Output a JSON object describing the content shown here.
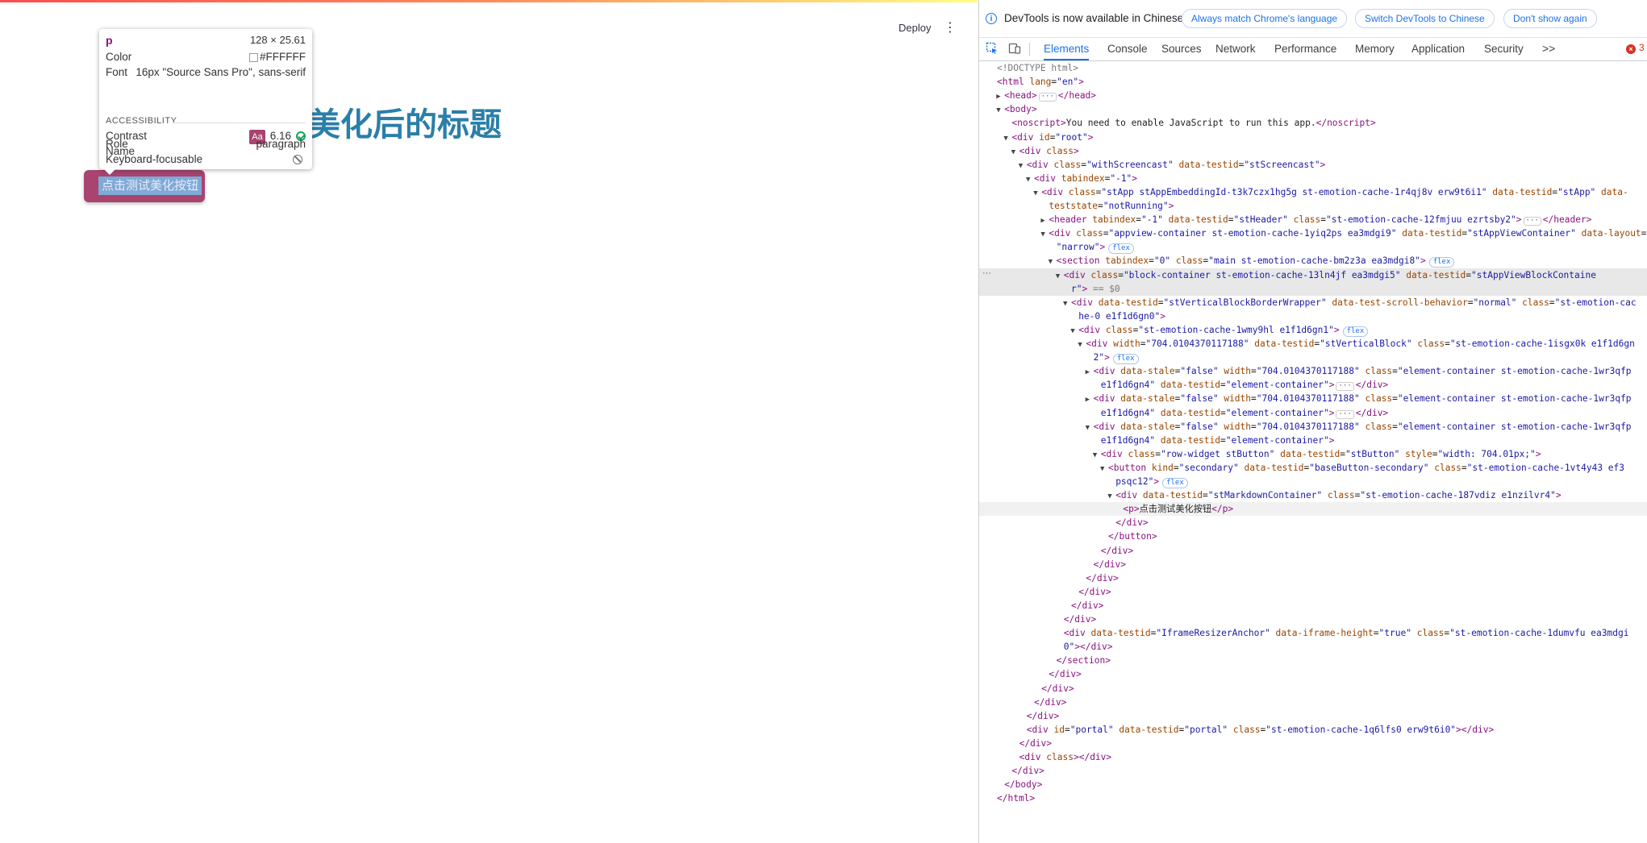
{
  "app": {
    "deploy_label": "Deploy",
    "kebab_icon": "⋮",
    "title_prefix": "",
    "title": "美化后的标题",
    "button_label": "点击测试美化按钮"
  },
  "inspector_tip": {
    "tag": "p",
    "size": "128 × 25.61",
    "color_label": "Color",
    "color_value": "#FFFFFF",
    "font_label": "Font",
    "font_value": "16px \"Source Sans Pro\", sans-serif",
    "section_label": "ACCESSIBILITY",
    "contrast_label": "Contrast",
    "contrast_aa": "Aa",
    "contrast_value": "6.16",
    "name_label": "Name",
    "role_label": "Role",
    "role_value": "paragraph",
    "keyboard_label": "Keyboard-focusable"
  },
  "devtools": {
    "notice": {
      "text": "DevTools is now available in Chinese!",
      "btn_match": "Always match Chrome's language",
      "btn_switch": "Switch DevTools to Chinese",
      "btn_dont": "Don't show again"
    },
    "tabs": {
      "elements": "Elements",
      "console": "Console",
      "sources": "Sources",
      "network": "Network",
      "performance": "Performance",
      "memory": "Memory",
      "application": "Application",
      "security": "Security",
      "more": ">>"
    },
    "error_count": "3",
    "dom_lines": [
      {
        "indent": 0,
        "tw": "",
        "html": "<span class=\"cm\">&lt;!DOCTYPE html&gt;</span>"
      },
      {
        "indent": 0,
        "tw": "",
        "html": "<span class=\"tag\">&lt;html</span> <span class=\"an\">lang</span>=<span class=\"av\">\"en\"</span><span class=\"tag\">&gt;</span>"
      },
      {
        "indent": 1,
        "tw": "▶",
        "html": "<span class=\"tag\">&lt;head&gt;</span><span class=\"ell\">···</span><span class=\"tag\">&lt;/head&gt;</span>"
      },
      {
        "indent": 1,
        "tw": "▼",
        "html": "<span class=\"tag\">&lt;body&gt;</span>"
      },
      {
        "indent": 2,
        "tw": "",
        "html": "<span class=\"tag\">&lt;noscript&gt;</span><span class=\"txt\">You need to enable JavaScript to run this app.</span><span class=\"tag\">&lt;/noscript&gt;</span>"
      },
      {
        "indent": 2,
        "tw": "▼",
        "html": "<span class=\"tag\">&lt;div</span> <span class=\"an\">id</span>=<span class=\"av\">\"root\"</span><span class=\"tag\">&gt;</span>"
      },
      {
        "indent": 3,
        "tw": "▼",
        "html": "<span class=\"tag\">&lt;div</span> <span class=\"an\">class</span><span class=\"tag\">&gt;</span>"
      },
      {
        "indent": 4,
        "tw": "▼",
        "html": "<span class=\"tag\">&lt;div</span> <span class=\"an\">class</span>=<span class=\"av\">\"withScreencast\"</span> <span class=\"an\">data-testid</span>=<span class=\"av\">\"stScreencast\"</span><span class=\"tag\">&gt;</span>"
      },
      {
        "indent": 5,
        "tw": "▼",
        "html": "<span class=\"tag\">&lt;div</span> <span class=\"an\">tabindex</span>=<span class=\"av\">\"-1\"</span><span class=\"tag\">&gt;</span>"
      },
      {
        "indent": 6,
        "tw": "▼",
        "html": "<span class=\"tag\">&lt;div</span> <span class=\"an\">class</span>=<span class=\"av\">\"stApp stAppEmbeddingId-t3k7czx1hg5g st-emotion-cache-1r4qj8v erw9t6i1\"</span> <span class=\"an\">data-testid</span>=<span class=\"av\">\"stApp\"</span> <span class=\"an\">data-</span>"
      },
      {
        "indent": 7,
        "tw": "",
        "html": "<span class=\"an\">teststate</span>=<span class=\"av\">\"notRunning\"</span><span class=\"tag\">&gt;</span>"
      },
      {
        "indent": 7,
        "tw": "▶",
        "html": "<span class=\"tag\">&lt;header</span> <span class=\"an\">tabindex</span>=<span class=\"av\">\"-1\"</span> <span class=\"an\">data-testid</span>=<span class=\"av\">\"stHeader\"</span> <span class=\"an\">class</span>=<span class=\"av\">\"st-emotion-cache-12fmjuu ezrtsby2\"</span><span class=\"tag\">&gt;</span><span class=\"ell\">···</span><span class=\"tag\">&lt;/header&gt;</span>"
      },
      {
        "indent": 7,
        "tw": "▼",
        "html": "<span class=\"tag\">&lt;div</span> <span class=\"an\">class</span>=<span class=\"av\">\"appview-container st-emotion-cache-1yiq2ps ea3mdgi9\"</span> <span class=\"an\">data-testid</span>=<span class=\"av\">\"stAppViewContainer\"</span> <span class=\"an\">data-layout</span>="
      },
      {
        "indent": 8,
        "tw": "",
        "html": "<span class=\"av\">\"narrow\"</span><span class=\"tag\">&gt;</span><span class=\"badge\">flex</span>"
      },
      {
        "indent": 8,
        "tw": "▼",
        "html": "<span class=\"tag\">&lt;section</span> <span class=\"an\">tabindex</span>=<span class=\"av\">\"0\"</span> <span class=\"an\">class</span>=<span class=\"av\">\"main st-emotion-cache-bm2z3a ea3mdgi8\"</span><span class=\"tag\">&gt;</span><span class=\"badge\">flex</span>"
      },
      {
        "indent": 9,
        "tw": "▼",
        "html": "<span class=\"tag\">&lt;div</span> <span class=\"an\">class</span>=<span class=\"av\">\"block-container st-emotion-cache-13ln4jf ea3mdgi5\"</span> <span class=\"an\">data-testid</span>=<span class=\"av\">\"stAppViewBlockContaine</span>",
        "cls": "hl"
      },
      {
        "indent": 10,
        "tw": "",
        "html": "<span class=\"av\">r\"</span><span class=\"tag\">&gt;</span> <span class=\"cm\">== $0</span>",
        "cls": "hl"
      },
      {
        "indent": 10,
        "tw": "▼",
        "html": "<span class=\"tag\">&lt;div</span> <span class=\"an\">data-testid</span>=<span class=\"av\">\"stVerticalBlockBorderWrapper\"</span> <span class=\"an\">data-test-scroll-behavior</span>=<span class=\"av\">\"normal\"</span> <span class=\"an\">class</span>=<span class=\"av\">\"st-emotion-cac</span>"
      },
      {
        "indent": 11,
        "tw": "",
        "html": "<span class=\"av\">he-0 e1f1d6gn0\"</span><span class=\"tag\">&gt;</span>"
      },
      {
        "indent": 11,
        "tw": "▼",
        "html": "<span class=\"tag\">&lt;div</span> <span class=\"an\">class</span>=<span class=\"av\">\"st-emotion-cache-1wmy9hl e1f1d6gn1\"</span><span class=\"tag\">&gt;</span><span class=\"badge\">flex</span>"
      },
      {
        "indent": 12,
        "tw": "▼",
        "html": "<span class=\"tag\">&lt;div</span> <span class=\"an\">width</span>=<span class=\"av\">\"704.0104370117188\"</span> <span class=\"an\">data-testid</span>=<span class=\"av\">\"stVerticalBlock\"</span> <span class=\"an\">class</span>=<span class=\"av\">\"st-emotion-cache-1isgx0k e1f1d6gn</span>"
      },
      {
        "indent": 13,
        "tw": "",
        "html": "<span class=\"av\">2\"</span><span class=\"tag\">&gt;</span><span class=\"badge\">flex</span>"
      },
      {
        "indent": 13,
        "tw": "▶",
        "html": "<span class=\"tag\">&lt;div</span> <span class=\"an\">data-stale</span>=<span class=\"av\">\"false\"</span> <span class=\"an\">width</span>=<span class=\"av\">\"704.0104370117188\"</span> <span class=\"an\">class</span>=<span class=\"av\">\"element-container st-emotion-cache-1wr3qfp</span>"
      },
      {
        "indent": 14,
        "tw": "",
        "html": "<span class=\"av\">e1f1d6gn4\"</span> <span class=\"an\">data-testid</span>=<span class=\"av\">\"element-container\"</span><span class=\"tag\">&gt;</span><span class=\"ell\">···</span><span class=\"tag\">&lt;/div&gt;</span>"
      },
      {
        "indent": 13,
        "tw": "▶",
        "html": "<span class=\"tag\">&lt;div</span> <span class=\"an\">data-stale</span>=<span class=\"av\">\"false\"</span> <span class=\"an\">width</span>=<span class=\"av\">\"704.0104370117188\"</span> <span class=\"an\">class</span>=<span class=\"av\">\"element-container st-emotion-cache-1wr3qfp</span>"
      },
      {
        "indent": 14,
        "tw": "",
        "html": "<span class=\"av\">e1f1d6gn4\"</span> <span class=\"an\">data-testid</span>=<span class=\"av\">\"element-container\"</span><span class=\"tag\">&gt;</span><span class=\"ell\">···</span><span class=\"tag\">&lt;/div&gt;</span>"
      },
      {
        "indent": 13,
        "tw": "▼",
        "html": "<span class=\"tag\">&lt;div</span> <span class=\"an\">data-stale</span>=<span class=\"av\">\"false\"</span> <span class=\"an\">width</span>=<span class=\"av\">\"704.0104370117188\"</span> <span class=\"an\">class</span>=<span class=\"av\">\"element-container st-emotion-cache-1wr3qfp</span>"
      },
      {
        "indent": 14,
        "tw": "",
        "html": "<span class=\"av\">e1f1d6gn4\"</span> <span class=\"an\">data-testid</span>=<span class=\"av\">\"element-container\"</span><span class=\"tag\">&gt;</span>"
      },
      {
        "indent": 14,
        "tw": "▼",
        "html": "<span class=\"tag\">&lt;div</span> <span class=\"an\">class</span>=<span class=\"av\">\"row-widget stButton\"</span> <span class=\"an\">data-testid</span>=<span class=\"av\">\"stButton\"</span> <span class=\"an\">style</span>=<span class=\"av\">\"width: 704.01px;\"</span><span class=\"tag\">&gt;</span>"
      },
      {
        "indent": 15,
        "tw": "▼",
        "html": "<span class=\"tag\">&lt;button</span> <span class=\"an\">kind</span>=<span class=\"av\">\"secondary\"</span> <span class=\"an\">data-testid</span>=<span class=\"av\">\"baseButton-secondary\"</span> <span class=\"an\">class</span>=<span class=\"av\">\"st-emotion-cache-1vt4y43 ef3</span>"
      },
      {
        "indent": 16,
        "tw": "",
        "html": "<span class=\"av\">psqc12\"</span><span class=\"tag\">&gt;</span><span class=\"badge\">flex</span>"
      },
      {
        "indent": 16,
        "tw": "▼",
        "html": "<span class=\"tag\">&lt;div</span> <span class=\"an\">data-testid</span>=<span class=\"av\">\"stMarkdownContainer\"</span> <span class=\"an\">class</span>=<span class=\"av\">\"st-emotion-cache-187vdiz e1nzilvr4\"</span><span class=\"tag\">&gt;</span>"
      },
      {
        "indent": 17,
        "tw": "",
        "html": "<span class=\"tag\">&lt;p&gt;</span><span class=\"txt\">点击测试美化按钮</span><span class=\"tag\">&lt;/p&gt;</span>",
        "cls": "sel"
      },
      {
        "indent": 16,
        "tw": "",
        "html": "<span class=\"tag\">&lt;/div&gt;</span>"
      },
      {
        "indent": 15,
        "tw": "",
        "html": "<span class=\"tag\">&lt;/button&gt;</span>"
      },
      {
        "indent": 14,
        "tw": "",
        "html": "<span class=\"tag\">&lt;/div&gt;</span>"
      },
      {
        "indent": 13,
        "tw": "",
        "html": "<span class=\"tag\">&lt;/div&gt;</span>"
      },
      {
        "indent": 12,
        "tw": "",
        "html": "<span class=\"tag\">&lt;/div&gt;</span>"
      },
      {
        "indent": 11,
        "tw": "",
        "html": "<span class=\"tag\">&lt;/div&gt;</span>"
      },
      {
        "indent": 10,
        "tw": "",
        "html": "<span class=\"tag\">&lt;/div&gt;</span>"
      },
      {
        "indent": 9,
        "tw": "",
        "html": "<span class=\"tag\">&lt;/div&gt;</span>"
      },
      {
        "indent": 9,
        "tw": "",
        "html": "<span class=\"tag\">&lt;div</span> <span class=\"an\">data-testid</span>=<span class=\"av\">\"IframeResizerAnchor\"</span> <span class=\"an\">data-iframe-height</span>=<span class=\"av\">\"true\"</span> <span class=\"an\">class</span>=<span class=\"av\">\"st-emotion-cache-1dumvfu ea3mdgi</span>"
      },
      {
        "indent": 9,
        "tw": "",
        "html": "<span class=\"av\">0\"</span><span class=\"tag\">&gt;&lt;/div&gt;</span>"
      },
      {
        "indent": 8,
        "tw": "",
        "html": "<span class=\"tag\">&lt;/section&gt;</span>"
      },
      {
        "indent": 7,
        "tw": "",
        "html": "<span class=\"tag\">&lt;/div&gt;</span>"
      },
      {
        "indent": 6,
        "tw": "",
        "html": "<span class=\"tag\">&lt;/div&gt;</span>"
      },
      {
        "indent": 5,
        "tw": "",
        "html": "<span class=\"tag\">&lt;/div&gt;</span>"
      },
      {
        "indent": 4,
        "tw": "",
        "html": "<span class=\"tag\">&lt;/div&gt;</span>"
      },
      {
        "indent": 4,
        "tw": "",
        "html": "<span class=\"tag\">&lt;div</span> <span class=\"an\">id</span>=<span class=\"av\">\"portal\"</span> <span class=\"an\">data-testid</span>=<span class=\"av\">\"portal\"</span> <span class=\"an\">class</span>=<span class=\"av\">\"st-emotion-cache-1q6lfs0 erw9t6i0\"</span><span class=\"tag\">&gt;&lt;/div&gt;</span>"
      },
      {
        "indent": 3,
        "tw": "",
        "html": "<span class=\"tag\">&lt;/div&gt;</span>"
      },
      {
        "indent": 3,
        "tw": "",
        "html": "<span class=\"tag\">&lt;div</span> <span class=\"an\">class</span><span class=\"tag\">&gt;&lt;/div&gt;</span>"
      },
      {
        "indent": 2,
        "tw": "",
        "html": "<span class=\"tag\">&lt;/div&gt;</span>"
      },
      {
        "indent": 1,
        "tw": "",
        "html": "<span class=\"tag\">&lt;/body&gt;</span>"
      },
      {
        "indent": 0,
        "tw": "",
        "html": "<span class=\"tag\">&lt;/html&gt;</span>"
      }
    ]
  }
}
